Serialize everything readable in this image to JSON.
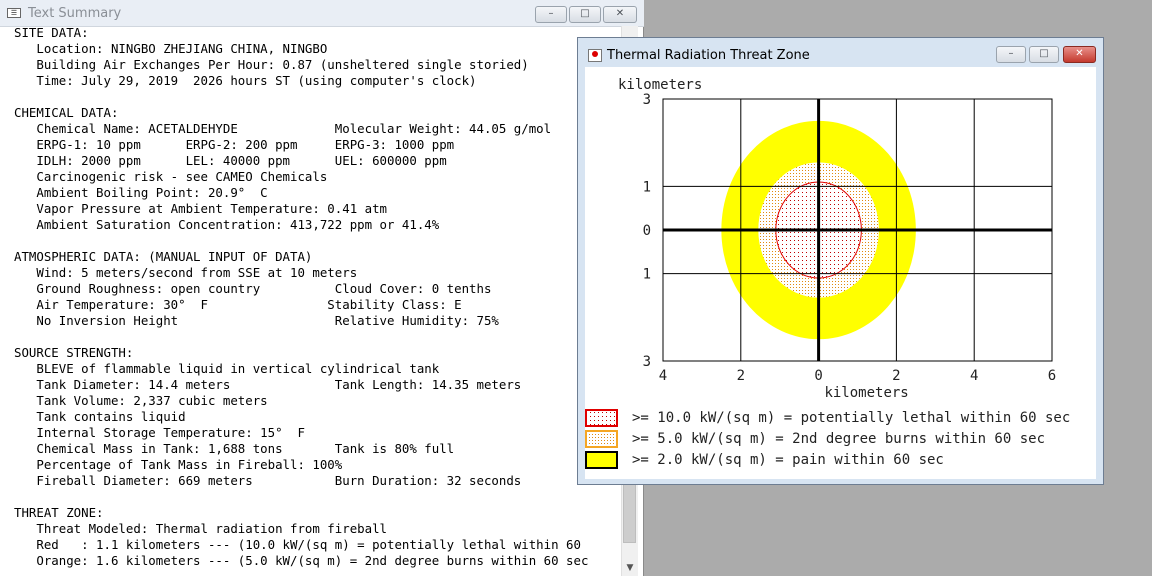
{
  "text_summary_window": {
    "title": "Text Summary",
    "icon_glyph": "☰",
    "buttons": {
      "minimize": "–",
      "maximize": "□",
      "close": "✕"
    },
    "scroll_down_glyph": "▼",
    "lines": [
      "SITE DATA:",
      "   Location: NINGBO ZHEJIANG CHINA, NINGBO",
      "   Building Air Exchanges Per Hour: 0.87 (unsheltered single storied)",
      "   Time: July 29, 2019  2026 hours ST (using computer's clock)",
      "",
      "CHEMICAL DATA:",
      "   Chemical Name: ACETALDEHYDE             Molecular Weight: 44.05 g/mol",
      "   ERPG-1: 10 ppm      ERPG-2: 200 ppm     ERPG-3: 1000 ppm",
      "   IDLH: 2000 ppm      LEL: 40000 ppm      UEL: 600000 ppm",
      "   Carcinogenic risk - see CAMEO Chemicals",
      "   Ambient Boiling Point: 20.9°  C",
      "   Vapor Pressure at Ambient Temperature: 0.41 atm",
      "   Ambient Saturation Concentration: 413,722 ppm or 41.4%",
      "",
      "ATMOSPHERIC DATA: (MANUAL INPUT OF DATA)",
      "   Wind: 5 meters/second from SSE at 10 meters",
      "   Ground Roughness: open country          Cloud Cover: 0 tenths",
      "   Air Temperature: 30°  F                Stability Class: E",
      "   No Inversion Height                     Relative Humidity: 75%",
      "",
      "SOURCE STRENGTH:",
      "   BLEVE of flammable liquid in vertical cylindrical tank",
      "   Tank Diameter: 14.4 meters              Tank Length: 14.35 meters",
      "   Tank Volume: 2,337 cubic meters",
      "   Tank contains liquid",
      "   Internal Storage Temperature: 15°  F",
      "   Chemical Mass in Tank: 1,688 tons       Tank is 80% full",
      "   Percentage of Tank Mass in Fireball: 100%",
      "   Fireball Diameter: 669 meters           Burn Duration: 32 seconds",
      "",
      "THREAT ZONE:",
      "   Threat Modeled: Thermal radiation from fireball",
      "   Red   : 1.1 kilometers --- (10.0 kW/(sq m) = potentially lethal within 60",
      "   Orange: 1.6 kilometers --- (5.0 kW/(sq m) = 2nd degree burns within 60 sec"
    ]
  },
  "threat_zone_window": {
    "title": "Thermal Radiation Threat Zone",
    "buttons": {
      "minimize": "–",
      "maximize": "□",
      "close": "✕"
    },
    "colors": {
      "red": "#e00000",
      "orange": "#f5a623",
      "yellow": "#ffff00",
      "red_fill": "#fbe7e7",
      "orange_fill": "#f7e8cc",
      "axis": "#000000",
      "grid": "#000000"
    },
    "chart_data": {
      "type": "map",
      "ylabel_top": "kilometers",
      "xlabel": "kilometers",
      "x_ticks": [
        -4,
        -2,
        0,
        2,
        4,
        6
      ],
      "x_tick_labels": [
        "4",
        "2",
        "0",
        "2",
        "4",
        "6"
      ],
      "y_ticks": [
        3,
        1,
        0,
        -1,
        -3
      ],
      "y_tick_labels": [
        "3",
        "1",
        "0",
        "1",
        "3"
      ],
      "xlim": [
        -4,
        6
      ],
      "ylim": [
        -3,
        3
      ],
      "zones": [
        {
          "color": "yellow",
          "radius_km": 2.5,
          "label": ">= 2.0 kW/(sq m) = pain within 60 sec"
        },
        {
          "color": "orange",
          "radius_km": 1.55,
          "label": ">= 5.0 kW/(sq m) = 2nd degree burns within 60 sec"
        },
        {
          "color": "red",
          "radius_km": 1.1,
          "label": ">= 10.0 kW/(sq m) = potentially lethal within 60 sec"
        }
      ],
      "legend_order": [
        "red",
        "orange",
        "yellow"
      ]
    }
  }
}
